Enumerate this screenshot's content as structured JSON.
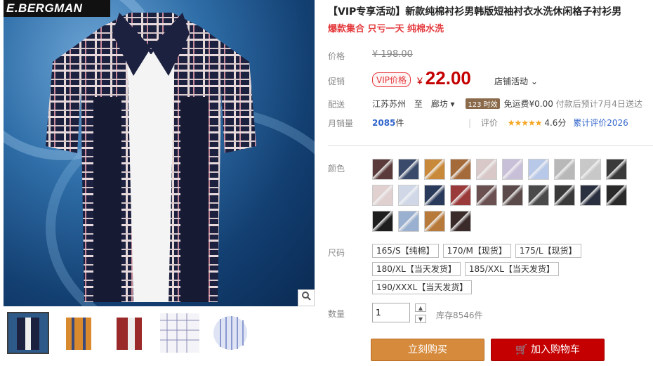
{
  "gallery": {
    "brand_logo": "E.BERGMAN",
    "zoom_icon": "magnifier-icon",
    "thumbnails": [
      "navy-plaid",
      "orange-plaid",
      "red-plaid",
      "white-grid",
      "blue-stripe"
    ]
  },
  "product": {
    "title": "【VIP专享活动】新款纯棉衬衫男韩版短袖衬衣水洗休闲格子衬衫男",
    "subtitle": "爆款集合 只亏一天 纯棉水洗"
  },
  "price": {
    "label": "价格",
    "original": "¥ 198.00"
  },
  "promo": {
    "label": "促销",
    "badge": "VIP价格",
    "currency": "¥",
    "value": "22.00",
    "shop_promo": "店铺活动"
  },
  "shipping": {
    "label": "配送",
    "from": "江苏苏州",
    "to_word": "至",
    "to": "廊坊",
    "badge": "123 时效",
    "fee": "免运费¥0.00",
    "eta": "付款后预计7月4日送达"
  },
  "sales": {
    "label": "月销量",
    "count": "2085",
    "unit": "件",
    "rating_label": "评价",
    "stars": "★★★★★",
    "score": "4.6分",
    "reviews": "累计评价2026"
  },
  "color": {
    "label": "颜色",
    "swatches": [
      "#5a3a3a",
      "#3a4a6a",
      "#c9893a",
      "#a56a3a",
      "#d8c8c8",
      "#c8c0d8",
      "#b8c8e8",
      "#b8b8b8",
      "#c8c8c8",
      "#3a3a3a",
      "#e0d0d0",
      "#d0d8e8",
      "#2a3a5a",
      "#9a3a3a",
      "#6a5050",
      "#5a4a4a",
      "#4a4a4a",
      "#3a3a3a",
      "#2a3040",
      "#2a2a2a",
      "#1e1e1e",
      "#9ab0d0",
      "#b87a3a",
      "#3a2a2a"
    ]
  },
  "size": {
    "label": "尺码",
    "options": [
      "165/S【纯棉】",
      "170/M【现货】",
      "175/L【现货】",
      "180/XL【当天发货】",
      "185/XXL【当天发货】",
      "190/XXXL【当天发货】"
    ]
  },
  "quantity": {
    "label": "数量",
    "value": "1",
    "stock": "库存8546件"
  },
  "actions": {
    "buy_now": "立刻购买",
    "add_to_cart": "加入购物车"
  }
}
